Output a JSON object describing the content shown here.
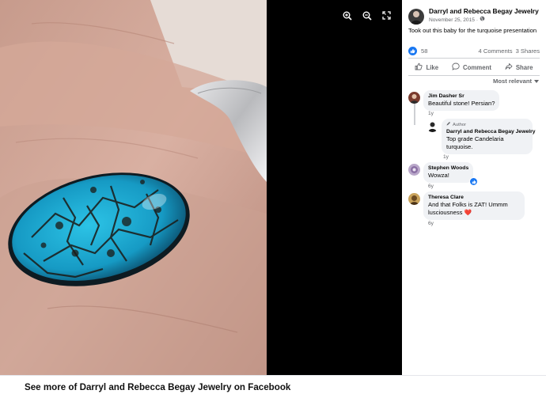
{
  "post": {
    "page_name": "Darryl and Rebecca Begay Jewelry",
    "date": "November 25, 2015",
    "date_separator": "·",
    "text": "Took out this baby for the turquoise presentation",
    "like_count": "58",
    "comments_count": "4 Comments",
    "shares_count": "3 Shares"
  },
  "actions": {
    "like": "Like",
    "comment": "Comment",
    "share": "Share"
  },
  "sort": {
    "label": "Most relevant"
  },
  "comments": [
    {
      "author": "Jim Dasher Sr",
      "text": "Beautiful stone! Persian?",
      "time": "1y"
    },
    {
      "author": "Darryl and Rebecca Begay Jewelry",
      "tag": "Author",
      "text": "Top grade Candelaria turquoise.",
      "time": "1y"
    },
    {
      "author": "Stephen Woods",
      "text": "Wowza!",
      "time": "6y"
    },
    {
      "author": "Theresa Clare",
      "text": "And that Folks is ZAT! Ummm lusciousness ❤️",
      "time": "6y"
    }
  ],
  "footer": {
    "link": "See more of Darryl and Rebecca Begay Jewelry on Facebook"
  },
  "colors": {
    "accent": "#1877f2",
    "secondary_text": "#65676b",
    "bubble": "#f0f2f5",
    "viewer_bg": "#000000",
    "turquoise": "#1fb2d8"
  },
  "icons": [
    "zoom-in-icon",
    "zoom-out-icon",
    "fullscreen-icon",
    "globe-icon",
    "like-icon",
    "comment-icon",
    "share-icon",
    "chevron-down-icon",
    "pencil-icon"
  ]
}
